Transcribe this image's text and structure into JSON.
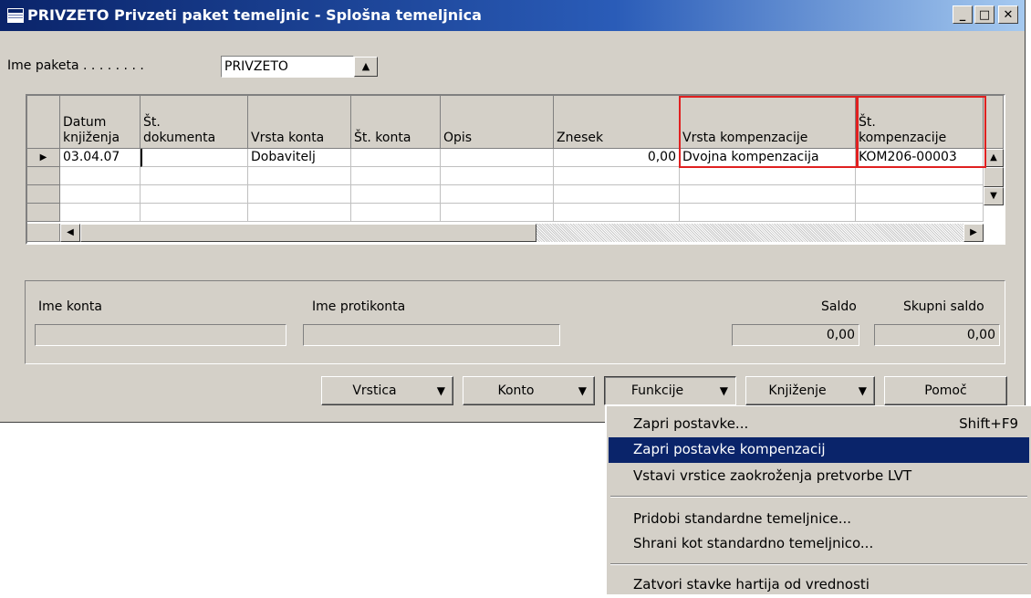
{
  "window": {
    "title": "PRIVZETO Privzeti paket temeljnic - Splošna temeljnica",
    "minimize": "_",
    "maximize": "□",
    "close": "✕"
  },
  "batch": {
    "label": "Ime paketa . . . . . . . .",
    "value": "PRIVZETO",
    "lookup_icon": "up-arrow"
  },
  "grid": {
    "headers": [
      [
        "Datum",
        "knjiženja"
      ],
      [
        "Št.",
        "dokumenta"
      ],
      [
        "Vrsta konta"
      ],
      [
        "Št. konta"
      ],
      [
        "Opis"
      ],
      [
        "Znesek"
      ],
      [
        "Vrsta kompenzacije"
      ],
      [
        "Št.",
        "kompenzacije"
      ]
    ],
    "row": {
      "datum": "03.04.07",
      "st_dokumenta": "",
      "vrsta_konta": "Dobavitelj",
      "st_konta": "",
      "opis": "",
      "znesek": "0,00",
      "vrsta_kompenzacije": "Dvojna kompenzacija",
      "st_kompenzacije": "KOM206-00003"
    },
    "highlight_color": "#e02020"
  },
  "info": {
    "ime_konta_label": "Ime konta",
    "ime_protikonta_label": "Ime protikonta",
    "saldo_label": "Saldo",
    "skupni_saldo_label": "Skupni saldo",
    "saldo_value": "0,00",
    "skupni_saldo_value": "0,00"
  },
  "buttons": {
    "vrstica": "Vrstica",
    "konto": "Konto",
    "funkcije": "Funkcije",
    "knjizenje": "Knjiženje",
    "pomoc": "Pomoč"
  },
  "menu": {
    "items": [
      {
        "label": "Zapri postavke...",
        "shortcut": "Shift+F9"
      },
      {
        "label": "Zapri postavke kompenzacij",
        "shortcut": ""
      },
      {
        "label": "Vstavi vrstice zaokroženja pretvorbe LVT",
        "shortcut": ""
      },
      {
        "label": "Pridobi standardne temeljnice...",
        "shortcut": ""
      },
      {
        "label": "Shrani kot standardno temeljnico...",
        "shortcut": ""
      },
      {
        "label": "Zatvori stavke hartija od vrednosti",
        "shortcut": ""
      }
    ],
    "highlight_color": "#0a246a"
  }
}
